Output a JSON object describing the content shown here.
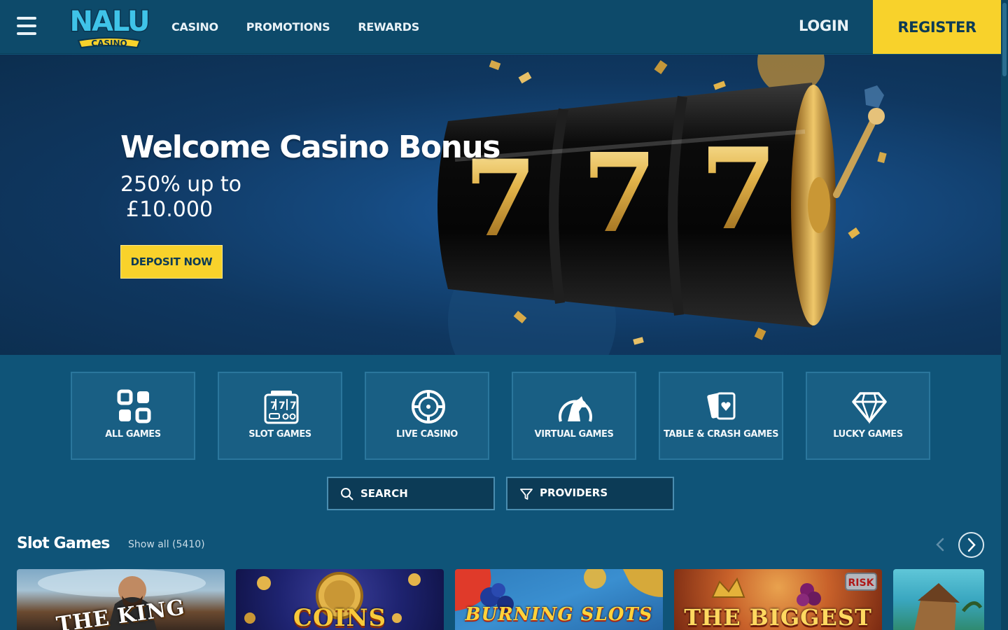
{
  "header": {
    "logo_text": "NALU",
    "logo_sub": "CASINO",
    "nav": [
      "CASINO",
      "PROMOTIONS",
      "REWARDS"
    ],
    "login_label": "LOGIN",
    "register_label": "REGISTER"
  },
  "hero": {
    "title": "Welcome Casino Bonus",
    "subtitle_line1": "250% up to",
    "subtitle_line2": "£10.000",
    "cta_label": "DEPOSIT NOW",
    "reel_digits": [
      "7",
      "7",
      "7"
    ]
  },
  "categories": [
    {
      "label": "ALL GAMES",
      "icon": "grid-icon"
    },
    {
      "label": "SLOT GAMES",
      "icon": "slot-machine-icon"
    },
    {
      "label": "LIVE CASINO",
      "icon": "roulette-chip-icon"
    },
    {
      "label": "VIRTUAL GAMES",
      "icon": "horse-icon"
    },
    {
      "label": "TABLE & CRASH GAMES",
      "icon": "cards-icon"
    },
    {
      "label": "LUCKY GAMES",
      "icon": "diamond-icon"
    }
  ],
  "search": {
    "placeholder": "SEARCH",
    "icon": "search-icon"
  },
  "providers": {
    "label": "PROVIDERS",
    "icon": "filter-icon"
  },
  "slot_section": {
    "title": "Slot Games",
    "show_all": "Show all (5410)"
  },
  "games": [
    {
      "title": "THE KING"
    },
    {
      "title": "COINS"
    },
    {
      "title": "BURNING SLOTS"
    },
    {
      "title": "THE BIGGEST"
    },
    {
      "title": ""
    }
  ],
  "colors": {
    "page_bg": "#0f5478",
    "header_bg": "#0d4a6a",
    "accent_yellow": "#f8d22b",
    "tile_bg": "#195f84"
  }
}
